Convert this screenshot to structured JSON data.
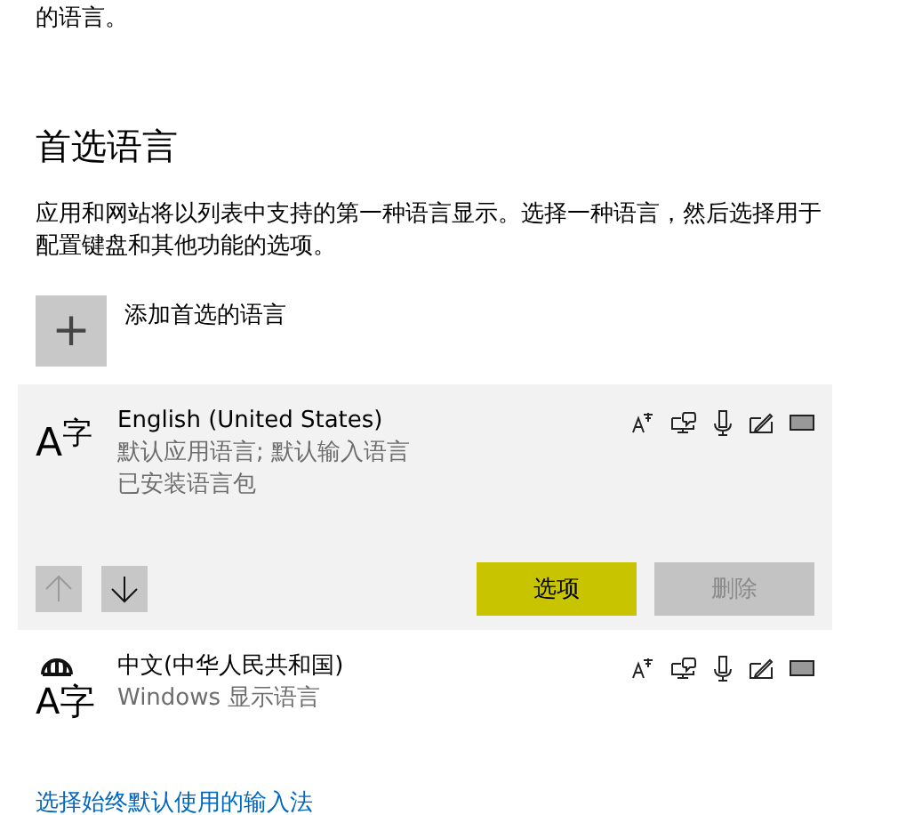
{
  "intro_tail": "的语言。",
  "section": {
    "title": "首选语言",
    "description": "应用和网站将以列表中支持的第一种语言显示。选择一种语言，然后选择用于配置键盘和其他功能的选项。"
  },
  "add_button": {
    "icon": "+",
    "label": "添加首选的语言"
  },
  "languages": [
    {
      "name": "English (United States)",
      "icon": "A$^{字}$",
      "globe": false,
      "details": [
        "默认应用语言; 默认输入语言",
        "已安装语言包"
      ],
      "selected": true,
      "move_up": {
        "disabled": true
      },
      "move_down": {
        "disabled": false
      },
      "actions": [
        {
          "label": "选项",
          "disabled": false,
          "highlighted": true
        },
        {
          "label": "删除",
          "disabled": true,
          "highlighted": false
        }
      ]
    },
    {
      "name": "中文(中华人民共和国)",
      "icon": "A字",
      "globe": true,
      "details": [
        "Windows 显示语言"
      ],
      "selected": false
    }
  ],
  "link": "选择始终默认使用的输入法"
}
